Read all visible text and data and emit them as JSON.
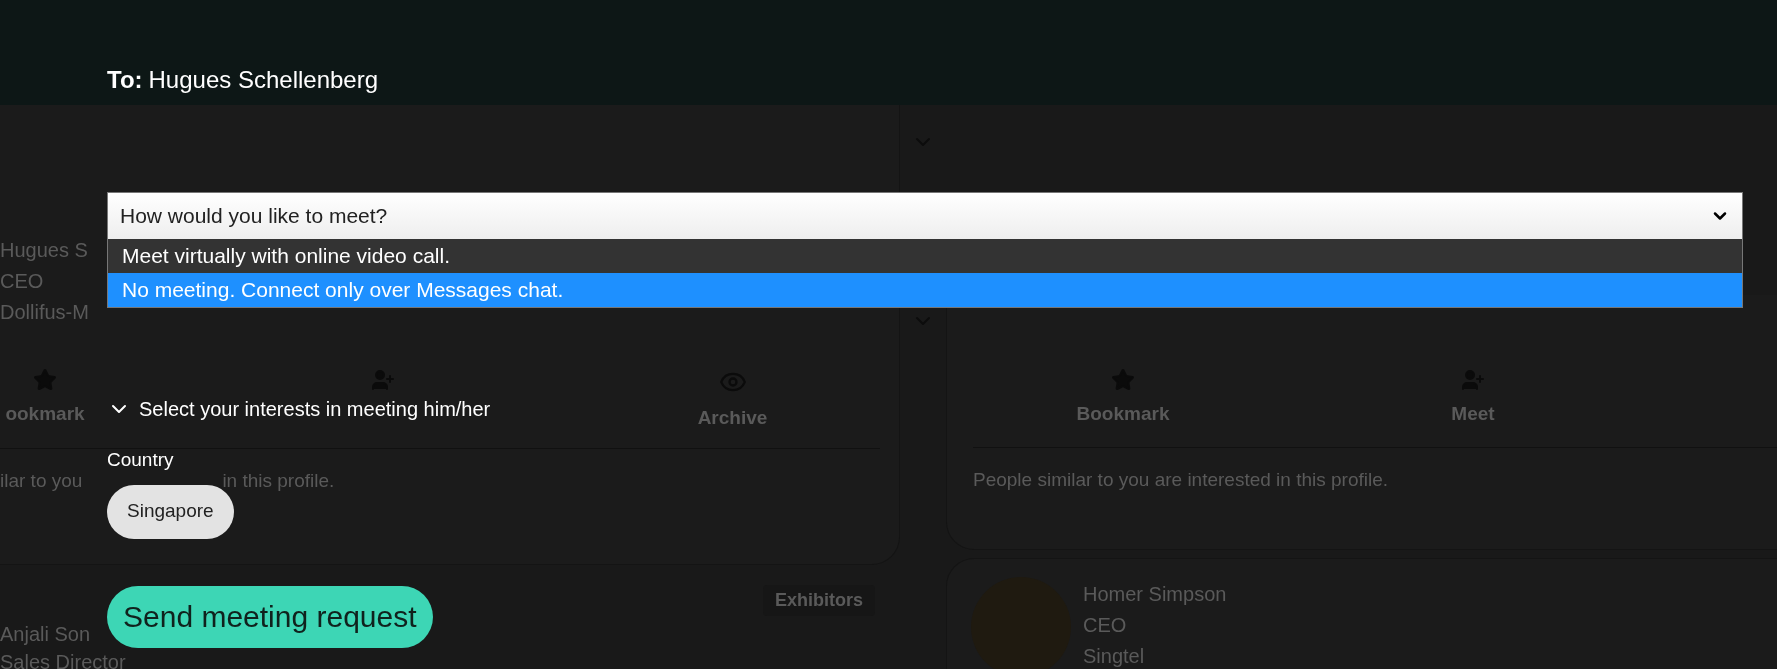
{
  "background": {
    "left_card": {
      "name": "Hugues S",
      "title": "CEO",
      "company": "Dollifus-M",
      "actions": [
        {
          "kind": "bookmark",
          "label": "ookmark"
        },
        {
          "kind": "meet"
        },
        {
          "kind": "archive",
          "label": "Archive"
        }
      ],
      "note_parts": [
        "ilar to you",
        "in this profile."
      ]
    },
    "exhibitor_badge": "Exhibitors",
    "left_contact": {
      "name": "Anjali Son",
      "title": "Sales Director"
    },
    "right_card": {
      "actions": [
        {
          "kind": "bookmark",
          "label": "Bookmark"
        },
        {
          "kind": "meet",
          "label": "Meet"
        }
      ],
      "note": "People similar to you are interested in this profile."
    },
    "right_contact": {
      "name": "Homer Simpson",
      "title": "CEO",
      "company": "Singtel"
    }
  },
  "modal": {
    "to_label": "To:",
    "recipient": "Hugues Schellenberg",
    "meeting_select": {
      "placeholder": "How would you like to meet?",
      "expanded": true,
      "options": [
        {
          "label": "Meet virtually with online video call.",
          "selected": false
        },
        {
          "label": "No meeting. Connect only over Messages chat.",
          "selected": true
        }
      ]
    },
    "interests": {
      "label": "Select your interests in meeting him/her",
      "expanded": true
    },
    "country_label": "Country",
    "country_tags": [
      {
        "label": "Singapore"
      }
    ],
    "submit": "Send meeting request"
  }
}
